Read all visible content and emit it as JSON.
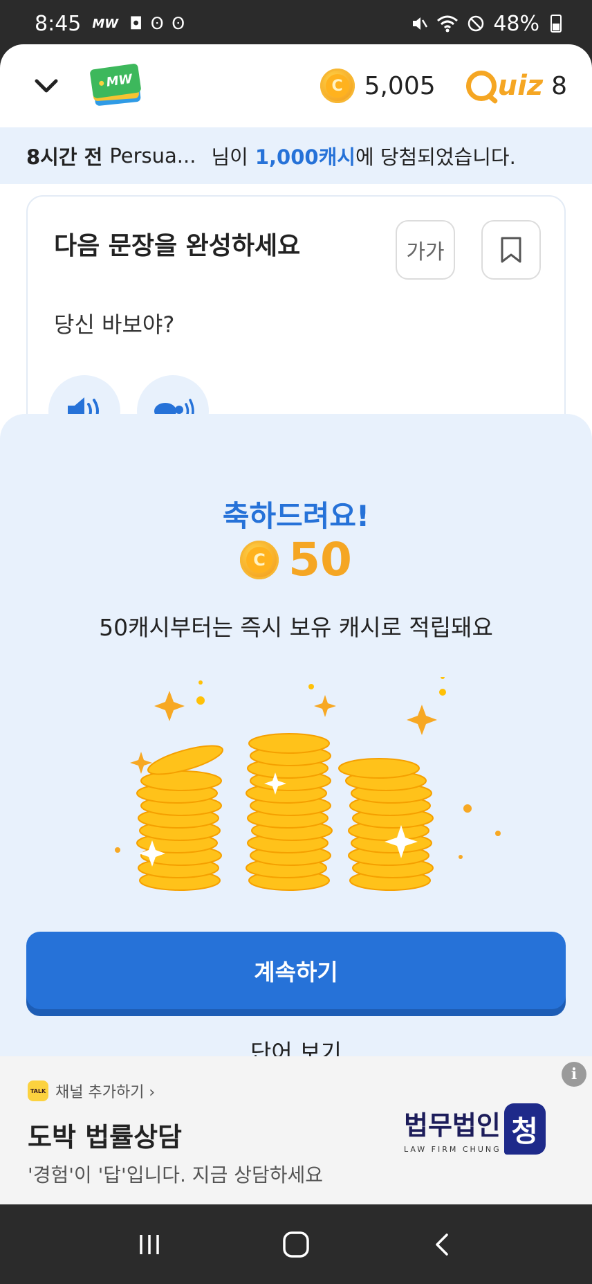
{
  "status_bar": {
    "time": "8:45",
    "app_icons": "MW",
    "notif_glyphs": "◘ ʘ ʘ",
    "battery": "48%"
  },
  "header": {
    "logo_text": "MW",
    "coin_count": "5,005",
    "quiz_label": "uiz",
    "quiz_count": "8"
  },
  "notice": {
    "time": "8시간 전",
    "user": "Persua...",
    "mid": "님이",
    "amount": "1,000캐시",
    "tail": "에 당첨되었습니다."
  },
  "quiz_card": {
    "title": "다음 문장을 완성하세요",
    "font_button": "가가",
    "question": "당신 바보야?"
  },
  "reward_sheet": {
    "congrats": "축하드려요!",
    "coin_symbol": "C",
    "reward_value": "50",
    "description": "50캐시부터는 즉시 보유 캐시로 적립돼요",
    "continue_label": "계속하기",
    "word_label": "단어 보기"
  },
  "ad": {
    "channel": "채널 추가하기 ›",
    "talk": "TALK",
    "title": "도박 법률상담",
    "subtitle": "'경험'이 '답'입니다. 지금 상담하세요",
    "brand_main": "법무법인",
    "brand_sub": "LAW FIRM CHUNG",
    "brand_char": "청",
    "info": "i"
  },
  "colors": {
    "accent": "#2672d8",
    "coin": "#f5a623",
    "sheet_bg": "#e8f1fc"
  }
}
